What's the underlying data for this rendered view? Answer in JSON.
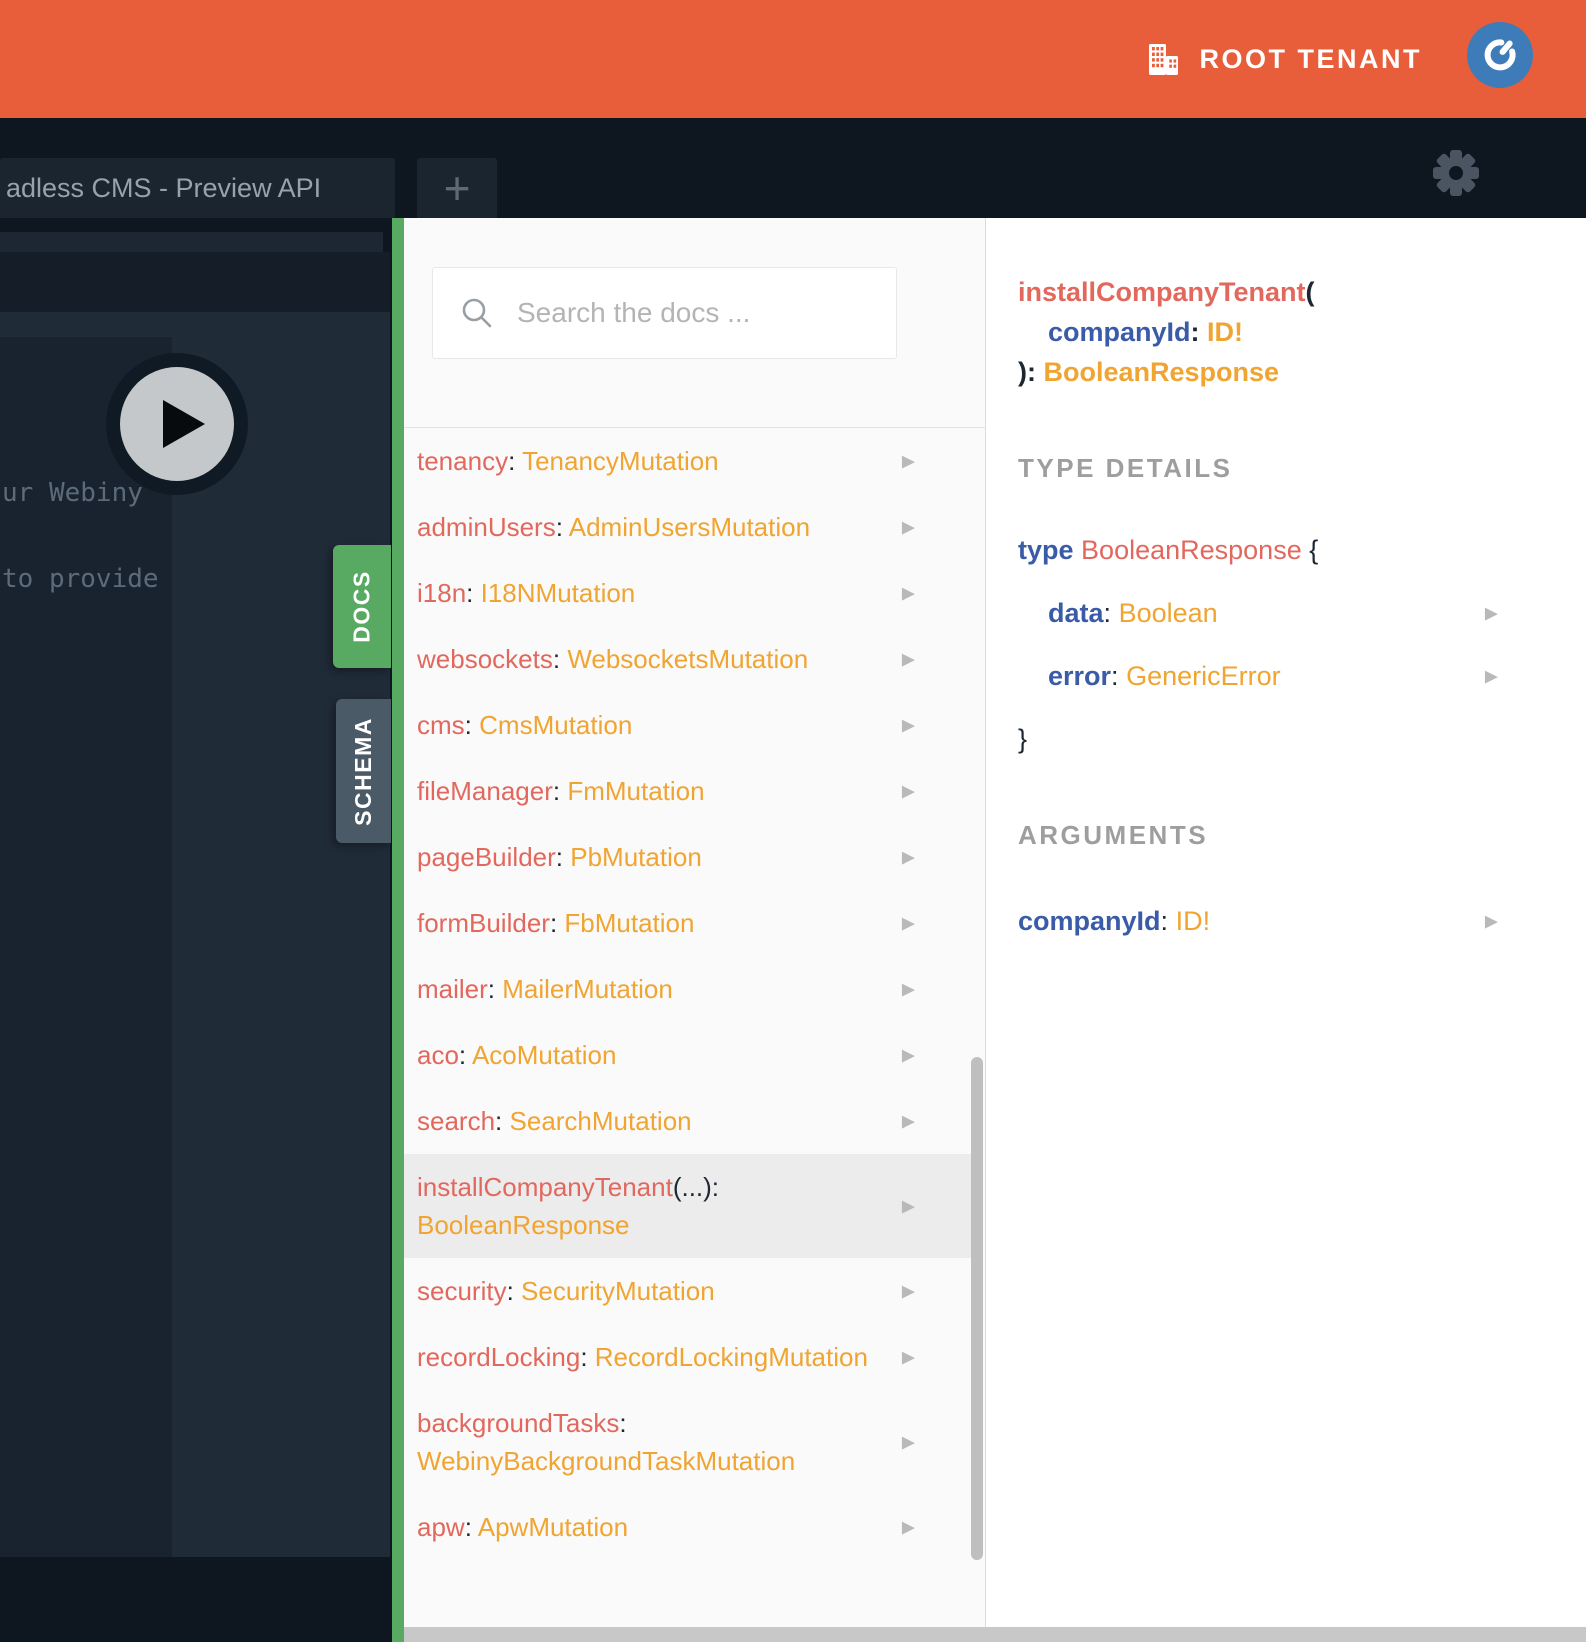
{
  "colors": {
    "header_orange": "#e85e3b",
    "accent_green": "#58a961",
    "schema_slate": "#4b5a67",
    "field_red": "#e2685e",
    "type_orange": "#f0a431",
    "keyword_blue": "#3a5ca8",
    "avatar_blue": "#3e7cb9",
    "chrome_dark": "#0e161f"
  },
  "header": {
    "tenant_label": "ROOT TENANT"
  },
  "tab_bar": {
    "active_tab_title": "adless CMS - Preview API",
    "new_tab_label": "+"
  },
  "editor": {
    "visible_text_lines": [
      "ur Webiny",
      "to provide"
    ]
  },
  "side_tabs": {
    "docs_label": "DOCS",
    "schema_label": "SCHEMA"
  },
  "icons": {
    "chevron_glyph": "▶"
  },
  "docs_panel": {
    "search_placeholder": "Search the docs ...",
    "args_ellipsis": "(...)",
    "colon": ":",
    "fields": [
      {
        "name": "tenancy",
        "type": "TenancyMutation"
      },
      {
        "name": "adminUsers",
        "type": "AdminUsersMutation"
      },
      {
        "name": "i18n",
        "type": "I18NMutation"
      },
      {
        "name": "websockets",
        "type": "WebsocketsMutation"
      },
      {
        "name": "cms",
        "type": "CmsMutation"
      },
      {
        "name": "fileManager",
        "type": "FmMutation"
      },
      {
        "name": "pageBuilder",
        "type": "PbMutation"
      },
      {
        "name": "formBuilder",
        "type": "FbMutation"
      },
      {
        "name": "mailer",
        "type": "MailerMutation"
      },
      {
        "name": "aco",
        "type": "AcoMutation"
      },
      {
        "name": "search",
        "type": "SearchMutation"
      },
      {
        "name": "installCompanyTenant",
        "type": "BooleanResponse",
        "has_args": true,
        "selected": true
      },
      {
        "name": "security",
        "type": "SecurityMutation"
      },
      {
        "name": "recordLocking",
        "type": "RecordLockingMutation"
      },
      {
        "name": "backgroundTasks",
        "type": "WebinyBackgroundTaskMutation"
      },
      {
        "name": "apw",
        "type": "ApwMutation"
      }
    ]
  },
  "detail_panel": {
    "signature": {
      "name": "installCompanyTenant",
      "paren_open": "(",
      "arg_name": "companyId",
      "colon": ":",
      "arg_type": "ID!",
      "paren_close_colon": "):",
      "return_type": "BooleanResponse"
    },
    "type_details": {
      "heading": "TYPE DETAILS",
      "keyword": "type",
      "type_name": "BooleanResponse",
      "brace_open": "{",
      "brace_close": "}",
      "fields": [
        {
          "name": "data",
          "type": "Boolean"
        },
        {
          "name": "error",
          "type": "GenericError"
        }
      ]
    },
    "arguments": {
      "heading": "ARGUMENTS",
      "items": [
        {
          "name": "companyId",
          "type": "ID!"
        }
      ]
    }
  }
}
